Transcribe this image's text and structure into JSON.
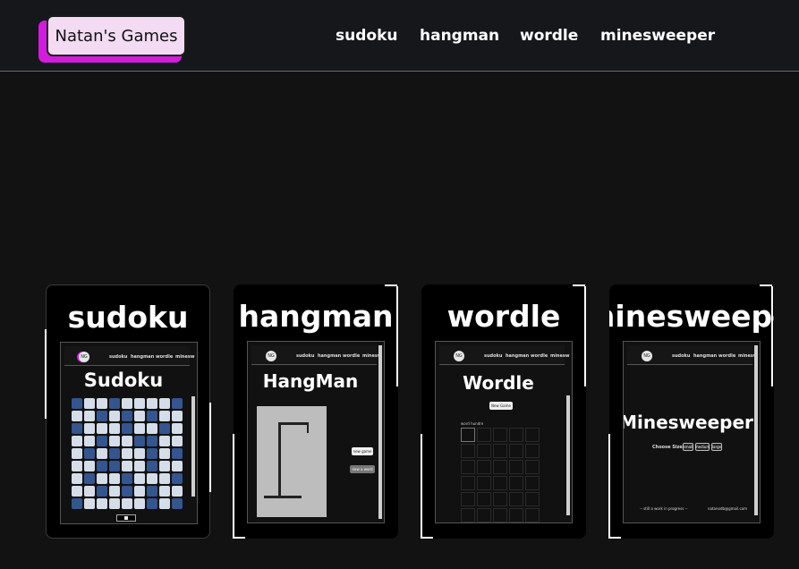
{
  "header": {
    "logo": "Natan's Games",
    "nav": [
      "sudoku",
      "hangman",
      "wordle",
      "minesweeper"
    ]
  },
  "cards": [
    {
      "title": "sudoku",
      "preview": {
        "logo": "NG",
        "nav": [
          "sudoku",
          "hangman",
          "wordle",
          "minesw"
        ],
        "heading": "Sudoku"
      }
    },
    {
      "title": "hangman",
      "preview": {
        "logo": "NG",
        "nav": [
          "sudoku",
          "hangman",
          "wordle",
          "minesw"
        ],
        "heading": "HangMan",
        "buttons": [
          "new game",
          "new a word"
        ]
      }
    },
    {
      "title": "wordle",
      "preview": {
        "logo": "NG",
        "nav": [
          "sudoku",
          "hangman",
          "wordle",
          "minesw"
        ],
        "heading": "Wordle",
        "button": "New Game",
        "label": "word hundre"
      }
    },
    {
      "title": "minesweeper",
      "preview": {
        "logo": "NG",
        "nav": [
          "sudoku",
          "hangman",
          "wordle",
          "minesw"
        ],
        "heading": "Minesweeper",
        "size_label": "Choose Size:",
        "sizes": [
          "small",
          "medium",
          "large"
        ],
        "footer_left": "-- still a work in progress --",
        "footer_right": "natanodb@gmail.com"
      }
    }
  ],
  "colors": {
    "background": "#121212",
    "header": "#15171b",
    "logo_bg": "#f3dcf3",
    "logo_shadow": "#d21cdc",
    "card": "#000000",
    "sudoku_light": "#d5dde9",
    "sudoku_dark": "#34558e"
  }
}
